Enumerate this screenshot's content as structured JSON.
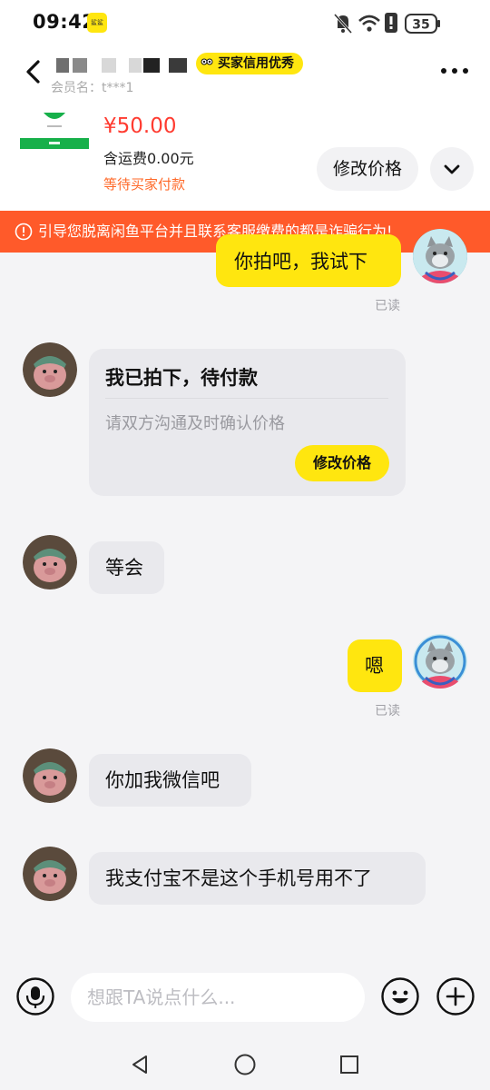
{
  "status_bar": {
    "time": "09:42",
    "notif_app_label": "鲨鲨",
    "battery": "35"
  },
  "header": {
    "credit_badge": "买家信用优秀",
    "member_name": "会员名：t***1",
    "product": {
      "price": "¥50.00",
      "shipping": "含运费0.00元",
      "status": "等待买家付款"
    },
    "edit_price_label": "修改价格"
  },
  "warning": {
    "text": "引导您脱离闲鱼平台并且联系客服缴费的都是诈骗行为!"
  },
  "messages": {
    "m1": {
      "text": "你拍吧，我试下",
      "read": "已读"
    },
    "card": {
      "title": "我已拍下，待付款",
      "subtitle": "请双方沟通及时确认价格",
      "button": "修改价格"
    },
    "m2": {
      "text": "等会"
    },
    "m3": {
      "text": "嗯",
      "read": "已读"
    },
    "m4": {
      "text": "你加我微信吧"
    },
    "m5": {
      "text": "我支付宝不是这个手机号用不了"
    }
  },
  "input": {
    "placeholder": "想跟TA说点什么..."
  },
  "colors": {
    "brand_yellow": "#ffe60f",
    "warning_red": "#ff5a2a",
    "price_red": "#ff3b30",
    "status_orange": "#ff6a2a",
    "bubble_gray": "#e9e9ed"
  },
  "icons": [
    "back-icon",
    "more-icon",
    "chevron-down-icon",
    "alert-icon",
    "microphone-icon",
    "emoji-icon",
    "plus-icon",
    "nav-back-icon",
    "nav-home-icon",
    "nav-recents-icon",
    "wifi-icon",
    "mute-icon",
    "battery-icon"
  ]
}
